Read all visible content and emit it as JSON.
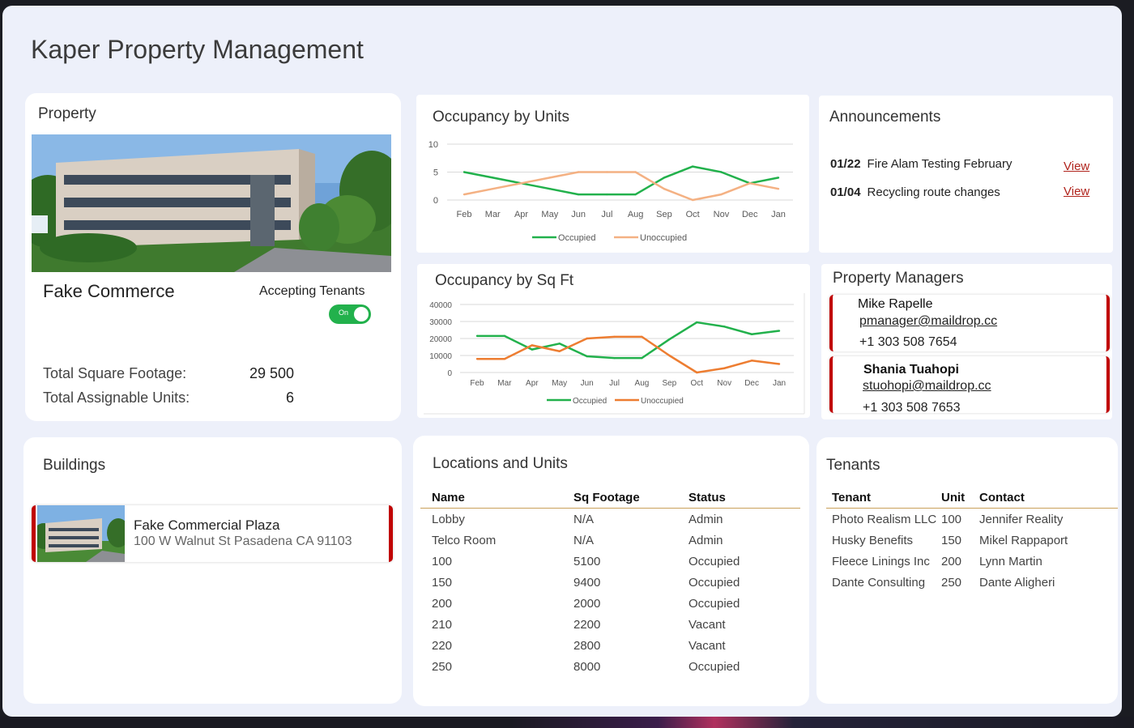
{
  "app": {
    "title": "Kaper Property Management"
  },
  "property": {
    "card_title": "Property",
    "name": "Fake Commerce",
    "accepting_label": "Accepting Tenants",
    "toggle_text": "On",
    "accepting": true,
    "stats": [
      {
        "label": "Total Square Footage:",
        "value": "29 500"
      },
      {
        "label": "Total Assignable Units:",
        "value": "6"
      }
    ]
  },
  "charts": {
    "units": {
      "title": "Occupancy by Units",
      "chart_data": {
        "type": "line",
        "title": "Occupancy by Units",
        "categories": [
          "Feb",
          "Mar",
          "Apr",
          "May",
          "Jun",
          "Jul",
          "Aug",
          "Sep",
          "Oct",
          "Nov",
          "Dec",
          "Jan"
        ],
        "series": [
          {
            "name": "Occupied",
            "color": "#22b14c",
            "values": [
              5,
              4,
              3,
              2,
              1,
              1,
              1,
              4,
              6,
              5,
              3,
              4
            ]
          },
          {
            "name": "Unoccupied",
            "color": "#f4b183",
            "values": [
              1,
              2,
              3,
              4,
              5,
              5,
              5,
              2,
              0,
              1,
              3,
              2
            ]
          }
        ],
        "yticks": [
          0,
          5,
          10
        ],
        "ylim": [
          0,
          10
        ],
        "legend": "bottom",
        "grid": true
      }
    },
    "sqft": {
      "title": "Occupancy by Sq Ft",
      "chart_data": {
        "type": "line",
        "title": "Occupancy by Sq Ft",
        "categories": [
          "Feb",
          "Mar",
          "Apr",
          "May",
          "Jun",
          "Jul",
          "Aug",
          "Sep",
          "Oct",
          "Nov",
          "Dec",
          "Jan"
        ],
        "series": [
          {
            "name": "Occupied",
            "color": "#22b14c",
            "values": [
              21500,
              21500,
              13500,
              17000,
              9500,
              8500,
              8500,
              19500,
              29500,
              27000,
              22500,
              24500
            ]
          },
          {
            "name": "Unoccupied",
            "color": "#ed7d31",
            "values": [
              8000,
              8000,
              16000,
              12500,
              20000,
              21000,
              21000,
              10000,
              0,
              2500,
              7000,
              5000
            ]
          }
        ],
        "yticks": [
          0,
          10000,
          20000,
          30000,
          40000
        ],
        "ylim": [
          0,
          40000
        ],
        "legend": "bottom",
        "grid": true
      }
    }
  },
  "announcements": {
    "title": "Announcements",
    "view_label": "View",
    "items": [
      {
        "date": "01/22",
        "text": "Fire Alam Testing February"
      },
      {
        "date": "01/04",
        "text": "Recycling route changes"
      }
    ]
  },
  "managers": {
    "title": "Property Managers",
    "items": [
      {
        "name": "Mike Rapelle",
        "email": "pmanager@maildrop.cc",
        "phone": "+1 303 508 7654"
      },
      {
        "name": "Shania Tuahopi",
        "email": "stuohopi@maildrop.cc",
        "phone": "+1 303 508 7653"
      }
    ]
  },
  "buildings": {
    "title": "Buildings",
    "items": [
      {
        "name": "Fake Commercial Plaza",
        "address": "100 W Walnut St Pasadena CA 91103"
      }
    ]
  },
  "locations": {
    "title": "Locations and Units",
    "headers": [
      "Name",
      "Sq Footage",
      "Status"
    ],
    "rows": [
      [
        "Lobby",
        "N/A",
        "Admin"
      ],
      [
        "Telco Room",
        "N/A",
        "Admin"
      ],
      [
        "100",
        "5100",
        "Occupied"
      ],
      [
        "150",
        "9400",
        "Occupied"
      ],
      [
        "200",
        "2000",
        "Occupied"
      ],
      [
        "210",
        "2200",
        "Vacant"
      ],
      [
        "220",
        "2800",
        "Vacant"
      ],
      [
        "250",
        "8000",
        "Occupied"
      ]
    ]
  },
  "tenants": {
    "title": "Tenants",
    "headers": [
      "Tenant",
      "Unit",
      "Contact"
    ],
    "rows": [
      [
        "Photo Realism LLC",
        "100",
        "Jennifer Reality"
      ],
      [
        "Husky Benefits",
        "150",
        "Mikel Rappaport"
      ],
      [
        "Fleece Linings Inc",
        "200",
        "Lynn Martin"
      ],
      [
        "Dante Consulting",
        "250",
        "Dante Aligheri"
      ]
    ]
  }
}
